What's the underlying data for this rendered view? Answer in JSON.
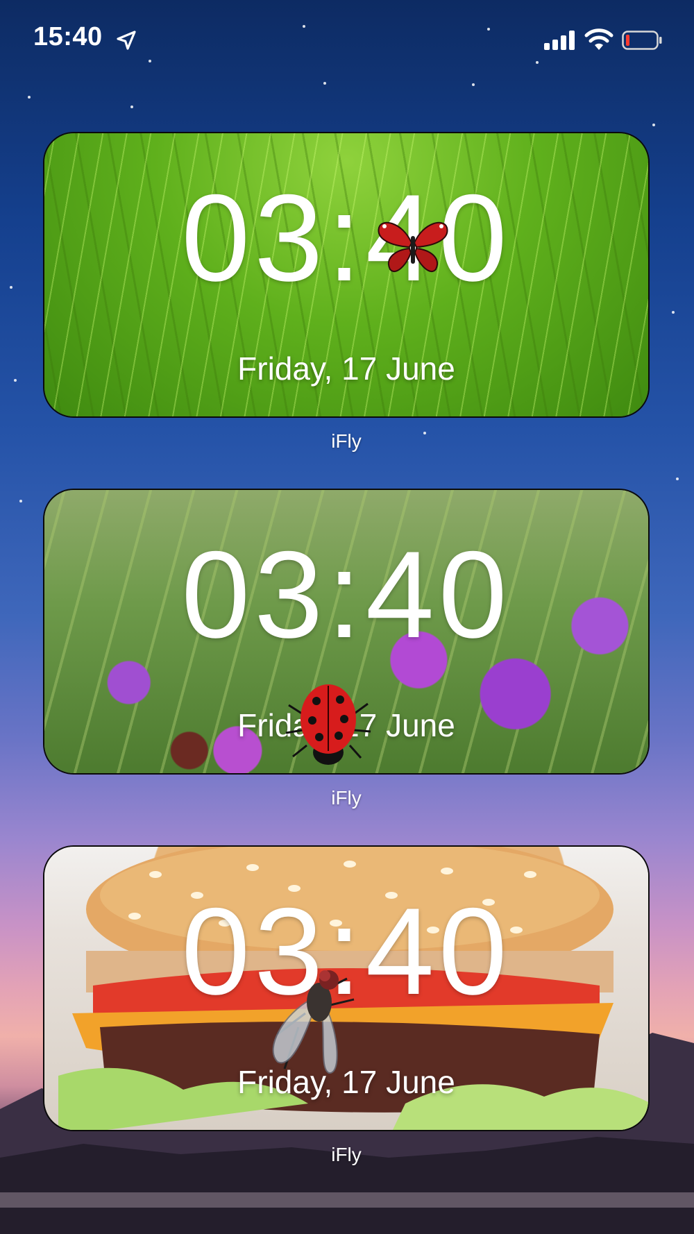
{
  "status_bar": {
    "time": "15:40",
    "icons": [
      "location-arrow-icon",
      "cellular-signal-icon",
      "wifi-icon",
      "battery-low-icon"
    ],
    "battery_color": "#ff3b30"
  },
  "widgets": [
    {
      "time": "03:40",
      "date": "Friday, 17 June",
      "app_label": "iFly",
      "background": "green grass",
      "insect": "butterfly-icon"
    },
    {
      "time": "03:40",
      "date": "Friday, 17 June",
      "app_label": "iFly",
      "background": "grass with purple flowers",
      "insect": "ladybug-icon"
    },
    {
      "time": "03:40",
      "date": "Friday, 17 June",
      "app_label": "iFly",
      "background": "cheeseburger",
      "insect": "fly-icon"
    }
  ]
}
